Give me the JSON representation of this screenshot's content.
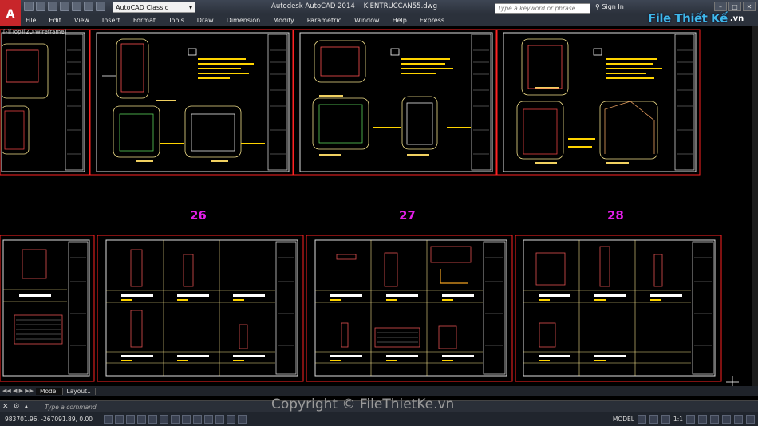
{
  "app": {
    "title": "Autodesk AutoCAD 2014",
    "filename": "KIENTRUCCAN55.dwg",
    "app_button": "A",
    "workspace": "AutoCAD Classic",
    "search_placeholder": "Type a keyword or phrase",
    "signin": "Sign In"
  },
  "menu": [
    "File",
    "Edit",
    "View",
    "Insert",
    "Format",
    "Tools",
    "Draw",
    "Dimension",
    "Modify",
    "Parametric",
    "Window",
    "Help",
    "Express"
  ],
  "viewport_label": "[-][Top][2D Wireframe]",
  "sheet_numbers": [
    "26",
    "27",
    "28"
  ],
  "tabs": [
    "Model",
    "Layout1"
  ],
  "command_prompt": "Type a command",
  "coordinates": "983701.96, -267091.89, 0.00",
  "status": {
    "model": "MODEL",
    "scale": "1:1"
  },
  "watermark": "Copyright © FileThietKe.vn",
  "logo": {
    "brand": "File Thiết Kế",
    "suffix": ".vn"
  },
  "colors": {
    "frame": "#ff2020",
    "sheet": "#e8e8e8",
    "accent": "#e31ee8",
    "titlebar": "#2b313b"
  }
}
